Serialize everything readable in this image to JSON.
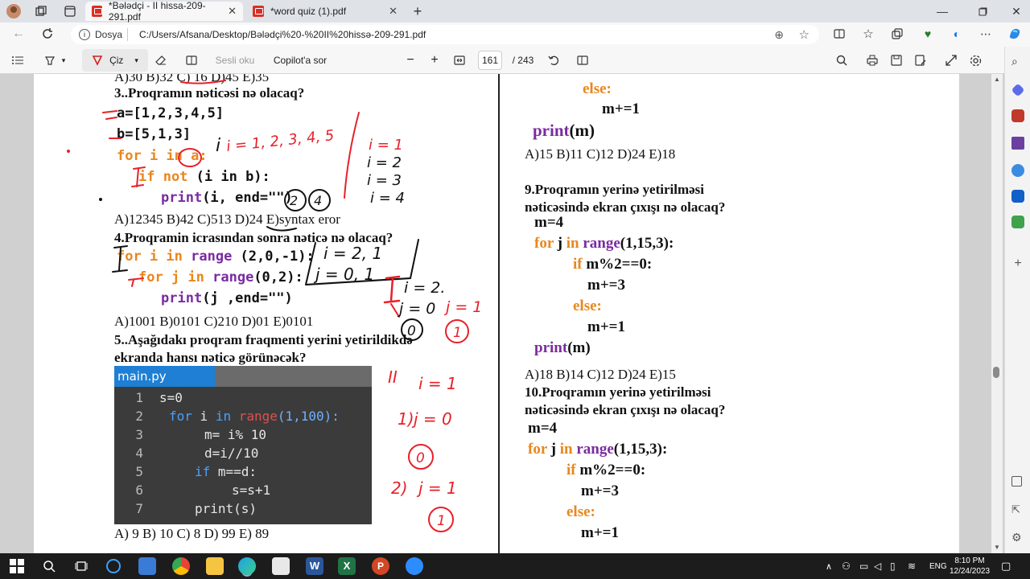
{
  "browser": {
    "tabs": [
      {
        "label": "*Bələdçi - II hissa-209-291.pdf",
        "active": true
      },
      {
        "label": "*word quiz (1).pdf",
        "active": false
      }
    ],
    "address": {
      "scheme_label": "Dosya",
      "path": "C:/Users/Afsana/Desktop/Bələdçi%20-%20II%20hissə-209-291.pdf"
    }
  },
  "pdf_toolbar": {
    "draw_label": "Çiz",
    "read_aloud_label": "Sesli oku",
    "copilot_label": "Copilot'a sor",
    "page_current": "161",
    "page_total": "/ 243"
  },
  "left_column": {
    "prev_answers": "A)30  B)32  C) 16  D)45  E)35",
    "q3": {
      "title": "3..Proqramın nəticəsi nə olacaq?",
      "code": [
        "a=[1,2,3,4,5]",
        "b=[5,1,3]"
      ],
      "for_kw": "for",
      "for_rest1": " i ",
      "in_kw": "in",
      "for_rest2": " a:",
      "if_kw": "if not",
      "if_rest": " (i in b):",
      "print_fn": "print",
      "print_rest": "(i, end=\"\")",
      "answers": "A)12345  B)42   C)513   D)24   E)syntax eror"
    },
    "q4": {
      "title": "4.Proqramin  icrasından sonra nəticə nə olacaq?",
      "line1_kw": "for i in",
      "line1_fn": " range",
      "line1_rest": " (2,0,-1):",
      "line2_kw": "for j in",
      "line2_fn": " range",
      "line2_rest": "(0,2):",
      "print_fn": "print",
      "print_rest": "(j ,end=\"\")",
      "answers": "A)1001      B)0101      C)210    D)01   E)0101"
    },
    "q5": {
      "title_line1": "5..Aşağıdakı proqram fraqmenti yerini yetirildikdə",
      "title_line2": "ekranda hansı nəticə görünəcək?",
      "answers": "A) 9      B) 10     C) 8    D) 99    E) 89"
    },
    "code_panel": {
      "filename": "main.py",
      "lines": [
        {
          "no": "1",
          "text": "s=0"
        },
        {
          "no": "2",
          "kw": "for",
          "a": " i ",
          "kw2": "in",
          "r": " range",
          "n": "(1,100):"
        },
        {
          "no": "3",
          "text": "m= i% 10"
        },
        {
          "no": "4",
          "text": "d=i//10"
        },
        {
          "no": "5",
          "kw": "if",
          "a": " m==d:"
        },
        {
          "no": "6",
          "text": "s=s+1"
        },
        {
          "no": "7",
          "text": "print(s)"
        }
      ]
    }
  },
  "right_column": {
    "top_else": "else:",
    "top_inc": "m+=1",
    "top_print_fn": "print",
    "top_print_rest": "(m)",
    "q8_answers": "A)15     B)11     C)12    D)24   E)18",
    "q9": {
      "title_line1": "9.Proqramın yerinə yetirilməsi",
      "title_line2": "nəticəsində ekran çıxışı nə olacaq?",
      "m_init": "m=4",
      "for_kw": "for",
      "for_a": " j ",
      "in_kw": "in",
      "range_fn": " range",
      "range_rest": "(1,15,3):",
      "if_kw": "if",
      "if_rest": " m%2==0:",
      "inc3": "m+=3",
      "else_kw": "else:",
      "inc1": "m+=1",
      "print_fn": "print",
      "print_rest": "(m)",
      "answers": "A)18     B)14     C)12     D)24    E)15"
    },
    "q10": {
      "title_line1": "10.Proqramın yerinə yetirilməsi",
      "title_line2": "nəticəsində ekran çıxışı nə olacaq?",
      "m_init": "m=4",
      "for_kw": "for",
      "for_a": " j ",
      "in_kw": "in",
      "range_fn": " range",
      "range_rest": "(1,15,3):",
      "if_kw": "if",
      "if_rest": " m%2==0:",
      "inc3": "m+=3",
      "else_kw": "else:",
      "inc1": "m+=1"
    }
  },
  "annotations": {
    "i_values": "i = 1, 2, 3, 4, 5",
    "i1": "i = 1",
    "i2": "i = 2",
    "i3": "i = 3",
    "i4": "i = 4",
    "res2": "2",
    "res4": "4",
    "i_eq": "i = 2, 1",
    "j_eq": "j = 0, 1",
    "I_mark": "I",
    "II_mark": "II",
    "i_two": "i = 2.",
    "j0": "j = 0",
    "j1": "j = 1",
    "zero": "0",
    "one": "1",
    "ii_i1": "i = 1",
    "ii_j0": "j = 0",
    "ii_zero": "0",
    "ii_j1": "j = 1",
    "ii_one": "1",
    "step1": "1)",
    "step2": "2)"
  },
  "taskbar": {
    "time": "8:10 PM",
    "date": "12/24/2023",
    "lang": "ENG"
  },
  "colors": {
    "accent": "#1e7fd4",
    "keyword": "#e8871e",
    "function": "#7a2ba0",
    "ink_red": "#e8202a"
  }
}
